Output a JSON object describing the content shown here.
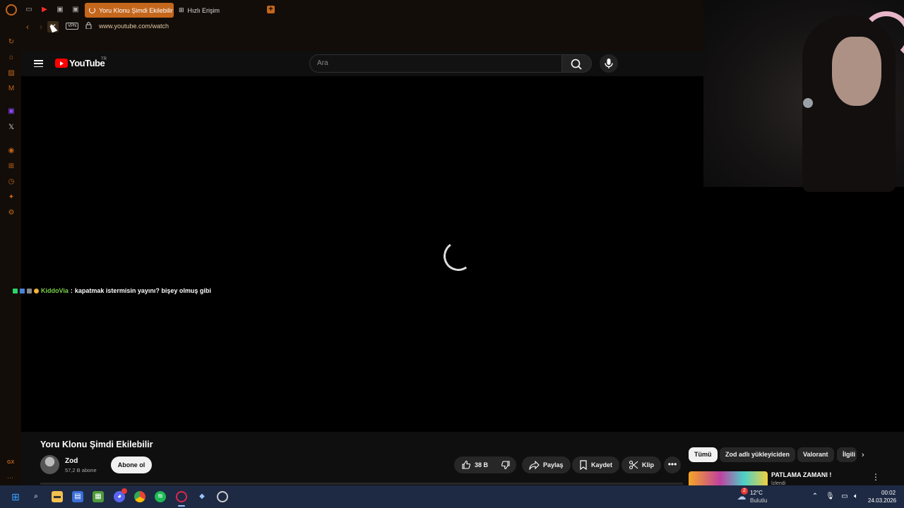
{
  "browser": {
    "active_tab_title": "Yoru Klonu Şimdi Ekilebilir",
    "second_tab_title": "Hızlı Erişim",
    "vpn_label": "VPN",
    "url": "www.youtube.com/watch",
    "sidebar_bottom_label": "GX",
    "accent_color": "#c4661c"
  },
  "youtube": {
    "logo_text": "YouTube",
    "country_code": "TR",
    "search_placeholder": "Ara"
  },
  "chat": {
    "username": "KiddoVia",
    "separator": ":",
    "message": "kapatmak istermisin yayını? bişey olmuş gibi"
  },
  "video": {
    "title": "Yoru Klonu Şimdi Ekilebilir",
    "channel_name": "Zod",
    "subscriber_count": "57,2 B abone",
    "subscribe_label": "Abone ol",
    "like_count": "38 B",
    "share_label": "Paylaş",
    "save_label": "Kaydet",
    "clip_label": "Klip",
    "more_label": "•••"
  },
  "recommendations": {
    "chips": [
      "Tümü",
      "Zod adlı yükleyiciden",
      "Valorant",
      "İlgili"
    ],
    "first_title": "PATLAMA ZAMANI !",
    "first_channel": "İzlendi"
  },
  "taskbar": {
    "notification_badge": "2",
    "weather_temp": "12°C",
    "weather_desc": "Bulutlu",
    "time": "00:02",
    "date": "24.03.2026"
  }
}
